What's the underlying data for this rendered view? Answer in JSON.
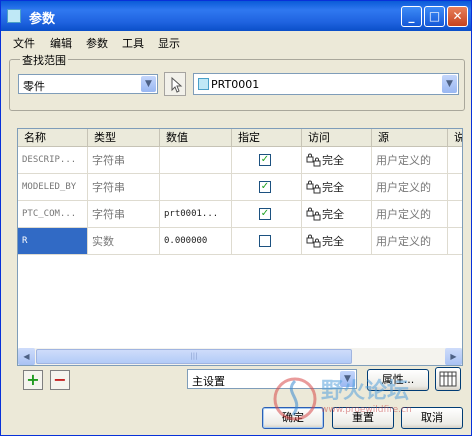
{
  "window": {
    "title": "参数",
    "buttons": {
      "minimize": "_",
      "maximize": "□",
      "close": "✕"
    }
  },
  "menu": [
    "文件",
    "编辑",
    "参数",
    "工具",
    "显示"
  ],
  "search_scope": {
    "legend": "查找范围",
    "type_value": "零件",
    "model_value": "PRT0001"
  },
  "table": {
    "columns": [
      "名称",
      "类型",
      "数值",
      "指定",
      "访问",
      "源",
      "说"
    ],
    "rows": [
      {
        "name": "DESCRIP...",
        "type": "字符串",
        "value": "",
        "designated": true,
        "access": "完全",
        "source": "用户定义的"
      },
      {
        "name": "MODELED_BY",
        "type": "字符串",
        "value": "",
        "designated": true,
        "access": "完全",
        "source": "用户定义的"
      },
      {
        "name": "PTC_COM...",
        "type": "字符串",
        "value": "prt0001...",
        "designated": true,
        "access": "完全",
        "source": "用户定义的"
      },
      {
        "name": "R",
        "type": "实数",
        "value": "0.000000",
        "designated": false,
        "access": "完全",
        "source": "用户定义的",
        "selected": true
      }
    ]
  },
  "bottom": {
    "add": "+",
    "remove": "−",
    "set_value": "主设置",
    "properties_label": "属性..."
  },
  "footer": {
    "ok": "确定",
    "reset": "重置",
    "cancel": "取消"
  },
  "watermark": {
    "text": "野火论坛",
    "url": "www.proewildfire.cn"
  },
  "colors": {
    "title_bar": "#0a5bd8",
    "selection": "#316ac5",
    "check": "#21a121",
    "add_green": "#1f9a1f",
    "remove_red": "#c42020"
  }
}
